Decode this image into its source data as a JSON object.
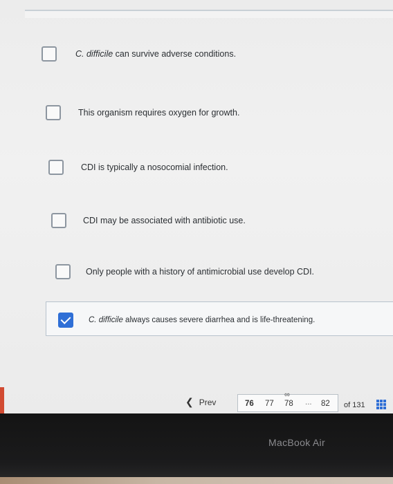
{
  "options": [
    {
      "label_italic": "C. difficile",
      "label_rest": " can survive adverse conditions.",
      "checked": false
    },
    {
      "label_italic": "",
      "label_rest": "This organism requires oxygen for growth.",
      "checked": false
    },
    {
      "label_italic": "",
      "label_rest": "CDI is typically a nosocomial infection.",
      "checked": false
    },
    {
      "label_italic": "",
      "label_rest": "CDI may be associated with antibiotic use.",
      "checked": false
    },
    {
      "label_italic": "",
      "label_rest": "Only people with a history of antimicrobial use develop CDI.",
      "checked": false
    },
    {
      "label_italic": "C. difficile",
      "label_rest": " always causes severe diarrhea and is life-threatening.",
      "checked": true
    }
  ],
  "pager": {
    "prev_label": "Prev",
    "pages": [
      "76",
      "77",
      "78"
    ],
    "current": "76",
    "ellipsis": "...",
    "last_page": "82",
    "of_total": "of 131",
    "link_symbol": "∞"
  },
  "device": {
    "brand": "MacBook Air"
  },
  "colors": {
    "accent": "#2f6fd6",
    "checkbox_border": "#8d96a0"
  }
}
